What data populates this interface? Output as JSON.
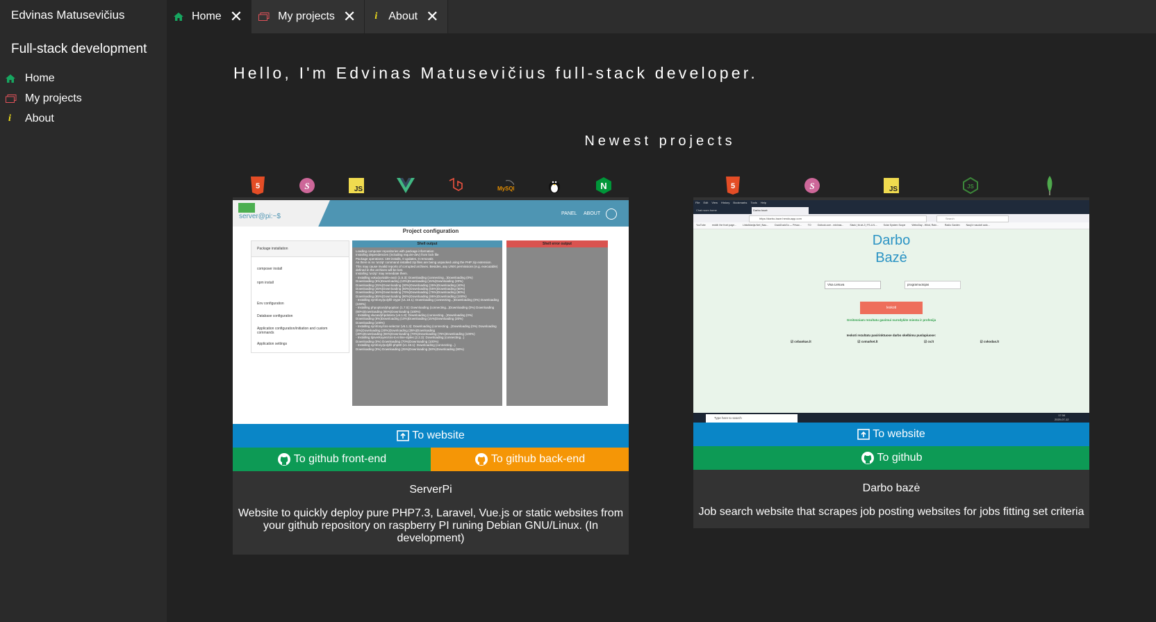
{
  "sidebar": {
    "owner": "Edvinas Matusevičius",
    "heading": "Full-stack development",
    "items": [
      {
        "label": "Home",
        "icon": "home-icon"
      },
      {
        "label": "My projects",
        "icon": "folder-icon"
      },
      {
        "label": "About",
        "icon": "info-icon"
      }
    ]
  },
  "tabs": [
    {
      "label": "Home",
      "icon": "home-icon",
      "active": true
    },
    {
      "label": "My projects",
      "icon": "folder-icon",
      "active": false
    },
    {
      "label": "About",
      "icon": "info-icon",
      "active": false
    }
  ],
  "main": {
    "greeting": "Hello, I'm Edvinas Matusevičius full-stack developer.",
    "newest_heading": "Newest projects"
  },
  "projects": [
    {
      "title": "ServerPi",
      "description": "Website to quickly deploy pure PHP7.3, Laravel, Vue.js or static websites from your github repository on raspberry PI runing Debian GNU/Linux. (In development)",
      "tech_icons": [
        "html5-icon",
        "sass-icon",
        "javascript-icon",
        "vue-icon",
        "laravel-icon",
        "mysql-icon",
        "linux-icon",
        "nginx-icon"
      ],
      "buttons": {
        "website": "To website",
        "github_front": "To github front-end",
        "github_back": "To github back-end"
      },
      "screenshot": {
        "prompt": "server@pi:~$",
        "nav_panel": "PANEL",
        "nav_about": "ABOUT",
        "page_heading": "Project configuration",
        "package_installation": "Package installation",
        "composer_install": "composer install",
        "npm_install": "npm install",
        "env_configuration": "Env configuration",
        "database_configuration": "Database configuration",
        "app_configuration": "Application configuration/initiation and custom commands",
        "app_settings": "Application settings",
        "shell_output": "Shell output",
        "shell_error_output": "Shell error output",
        "shell_lines": [
          "Loading composer repositories with package information",
          "Installing dependencies (including require-dev) from lock file",
          "Package operations: 159 installs, 0 updates, 0 removals",
          "As there is no 'unzip' command installed zip files are being unpacked using the PHP zip extension.",
          "This may cause invalid reports of corrupted archives. Besides, any UNIX permissions (e.g. executable) defined in the archives will be lost.",
          "Installing 'unzip' may remediate them.",
          " - Installing voku/portable-ascii (1.5.3): Downloading (connecting...)Downloading (0%)",
          "Downloading (5%)Downloading (10%)Downloading (15%)Downloading (20%)",
          "Downloading (25%)Downloading (30%)Downloading (35%)Downloading (40%)",
          "Downloading (45%)Downloading (50%)Downloading (55%)Downloading (60%)",
          "Downloading (65%)Downloading (70%)Downloading (75%)Downloading (80%)",
          "Downloading (85%)Downloading (90%)Downloading (95%)Downloading (100%)",
          " - Installing symfony/polyfill-ctype (v1.18.1): Downloading (connecting...)Downloading (0%)        Downloading (100%)",
          " - Installing phpoption/phpoption (1.7.5): Downloading (connecting...)Downloading (0%)        Downloading (60%)Downloading (95%)Downloading (100%)",
          " - Installing vlucas/phpdotenv (v4.1.8): Downloading (connecting...)Downloading (0%)",
          "Downloading (5%)Downloading (10%)Downloading (15%)Downloading (20%)",
          "Downloading (100%)",
          " - Installing symfony/css-selector (v5.1.3): Downloading (connecting...)Downloading (0%)        Downloading (5%)Downloading (30%)Downloading (35%)Downloading",
          "(40%)Downloading (65%)Downloading (70%)Downloading (75%)Downloading (100%)",
          " - Installing tijsverkoyen/css-to-inline-styles (2.2.3): Downloading (connecting...)",
          "Downloading (0%)        Downloading (70%)Downloading (100%)",
          " - Installing symfony/polyfill-php80 (v1.18.1): Downloading (connecting...)",
          "Downloading (0%)        Downloading (25%)Downloading (50%)Downloading (90%)"
        ]
      }
    },
    {
      "title": "Darbo bazė",
      "description": "Job search website that scrapes job posting websites for jobs fitting set criteria",
      "tech_icons": [
        "html5-icon",
        "sass-icon",
        "javascript-icon",
        "nodejs-icon",
        "mongodb-icon"
      ],
      "buttons": {
        "website": "To website",
        "github": "To github"
      },
      "screenshot": {
        "menu": [
          "File",
          "Edit",
          "View",
          "History",
          "Bookmarks",
          "Tools",
          "Help"
        ],
        "tab1": "Chat room home",
        "tab2": "Darbo bazė",
        "url": "https://darbo-baze.herokuapp.com",
        "search_placeholder": "Search",
        "bookmarks": [
          "YouTube",
          "reddit: the front page...",
          "LinksManija.Net | Nau...",
          "DuckDuckGo — Privac...",
          "TO",
          "Outlook.com - edvinas...",
          "Slack | tb-lvl-2 | FS-LVL...",
          "Solar System Scope",
          "WeboDay - Wind, Rain...",
          "Radio Garden",
          "Nauji ir naudoti auto..."
        ],
        "logo_line1": "Darbo",
        "logo_line2": "Bazė",
        "city_select": "Visa Lietuva",
        "profession_input": "programuotojas",
        "search_button": "Ieskoti",
        "hint": "Greitesniam rezultatu gavimui nurodykite miesta ir profesija",
        "sites_heading": "Ieskoti rezultatu pasirinktuose darbo skelbimu puslapiuose:",
        "sites": [
          "cvbankas.lt",
          "cvmarket.lt",
          "cv.lt",
          "cvkodas.lt"
        ],
        "taskbar_search": "Type here to search",
        "time": "17:34",
        "date": "2020-07-12"
      }
    }
  ],
  "colors": {
    "website_button": "#0a86c7",
    "github_button": "#0d9a55",
    "github_back_button": "#f59606",
    "home_icon": "#17a660",
    "folder_icon": "#e0525a",
    "info_icon": "#f5e31a"
  }
}
